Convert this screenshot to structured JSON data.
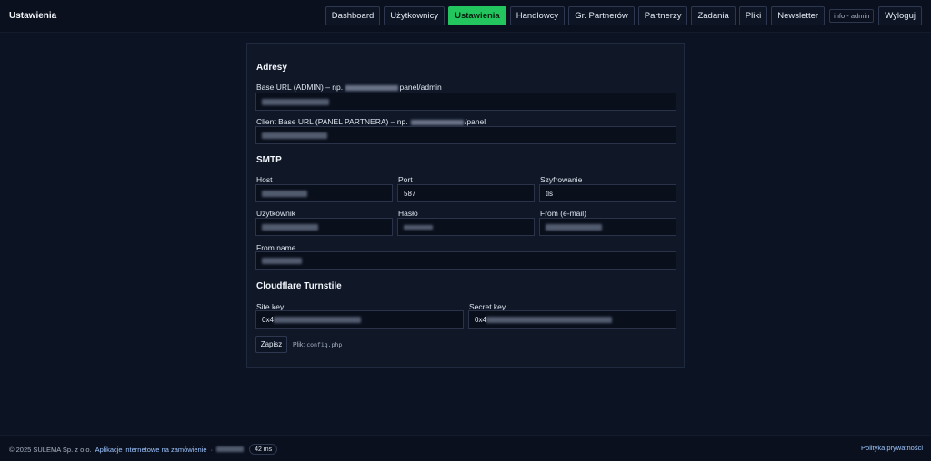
{
  "header": {
    "title": "Ustawienia",
    "nav": [
      {
        "label": "Dashboard",
        "active": false
      },
      {
        "label": "Użytkownicy",
        "active": false
      },
      {
        "label": "Ustawienia",
        "active": true
      },
      {
        "label": "Handlowcy",
        "active": false
      },
      {
        "label": "Gr. Partnerów",
        "active": false
      },
      {
        "label": "Partnerzy",
        "active": false
      },
      {
        "label": "Zadania",
        "active": false
      },
      {
        "label": "Pliki",
        "active": false
      },
      {
        "label": "Newsletter",
        "active": false
      }
    ],
    "user_badge": "info - admin",
    "logout_label": "Wyloguj"
  },
  "addresses": {
    "title": "Adresy",
    "base_url_label_prefix": "Base URL (ADMIN) – np. ",
    "base_url_label_suffix": "panel/admin",
    "client_url_label_prefix": "Client Base URL (PANEL PARTNERA) – np. ",
    "client_url_label_suffix": "/panel"
  },
  "smtp": {
    "title": "SMTP",
    "host_label": "Host",
    "port_label": "Port",
    "port_value": "587",
    "encryption_label": "Szyfrowanie",
    "encryption_value": "tls",
    "user_label": "Użytkownik",
    "password_label": "Hasło",
    "from_email_label": "From (e-mail)",
    "from_name_label": "From name"
  },
  "turnstile": {
    "title": "Cloudflare Turnstile",
    "site_key_label": "Site key",
    "site_key_prefix": "0x4",
    "secret_key_label": "Secret key",
    "secret_key_prefix": "0x4"
  },
  "actions": {
    "save_label": "Zapisz",
    "file_label": "Plik:",
    "file_name": "config.php"
  },
  "footer": {
    "copyright": "© 2025 SULEMA Sp. z o.o.",
    "link_text": "Aplikacje internetowe na zamówienie",
    "separator": "·",
    "timing": "42 ms",
    "privacy_label": "Polityka prywatności"
  },
  "colors": {
    "background": "#0c1322",
    "card": "#101828",
    "active_accent": "#22c55e",
    "link": "#9ec5ff"
  }
}
